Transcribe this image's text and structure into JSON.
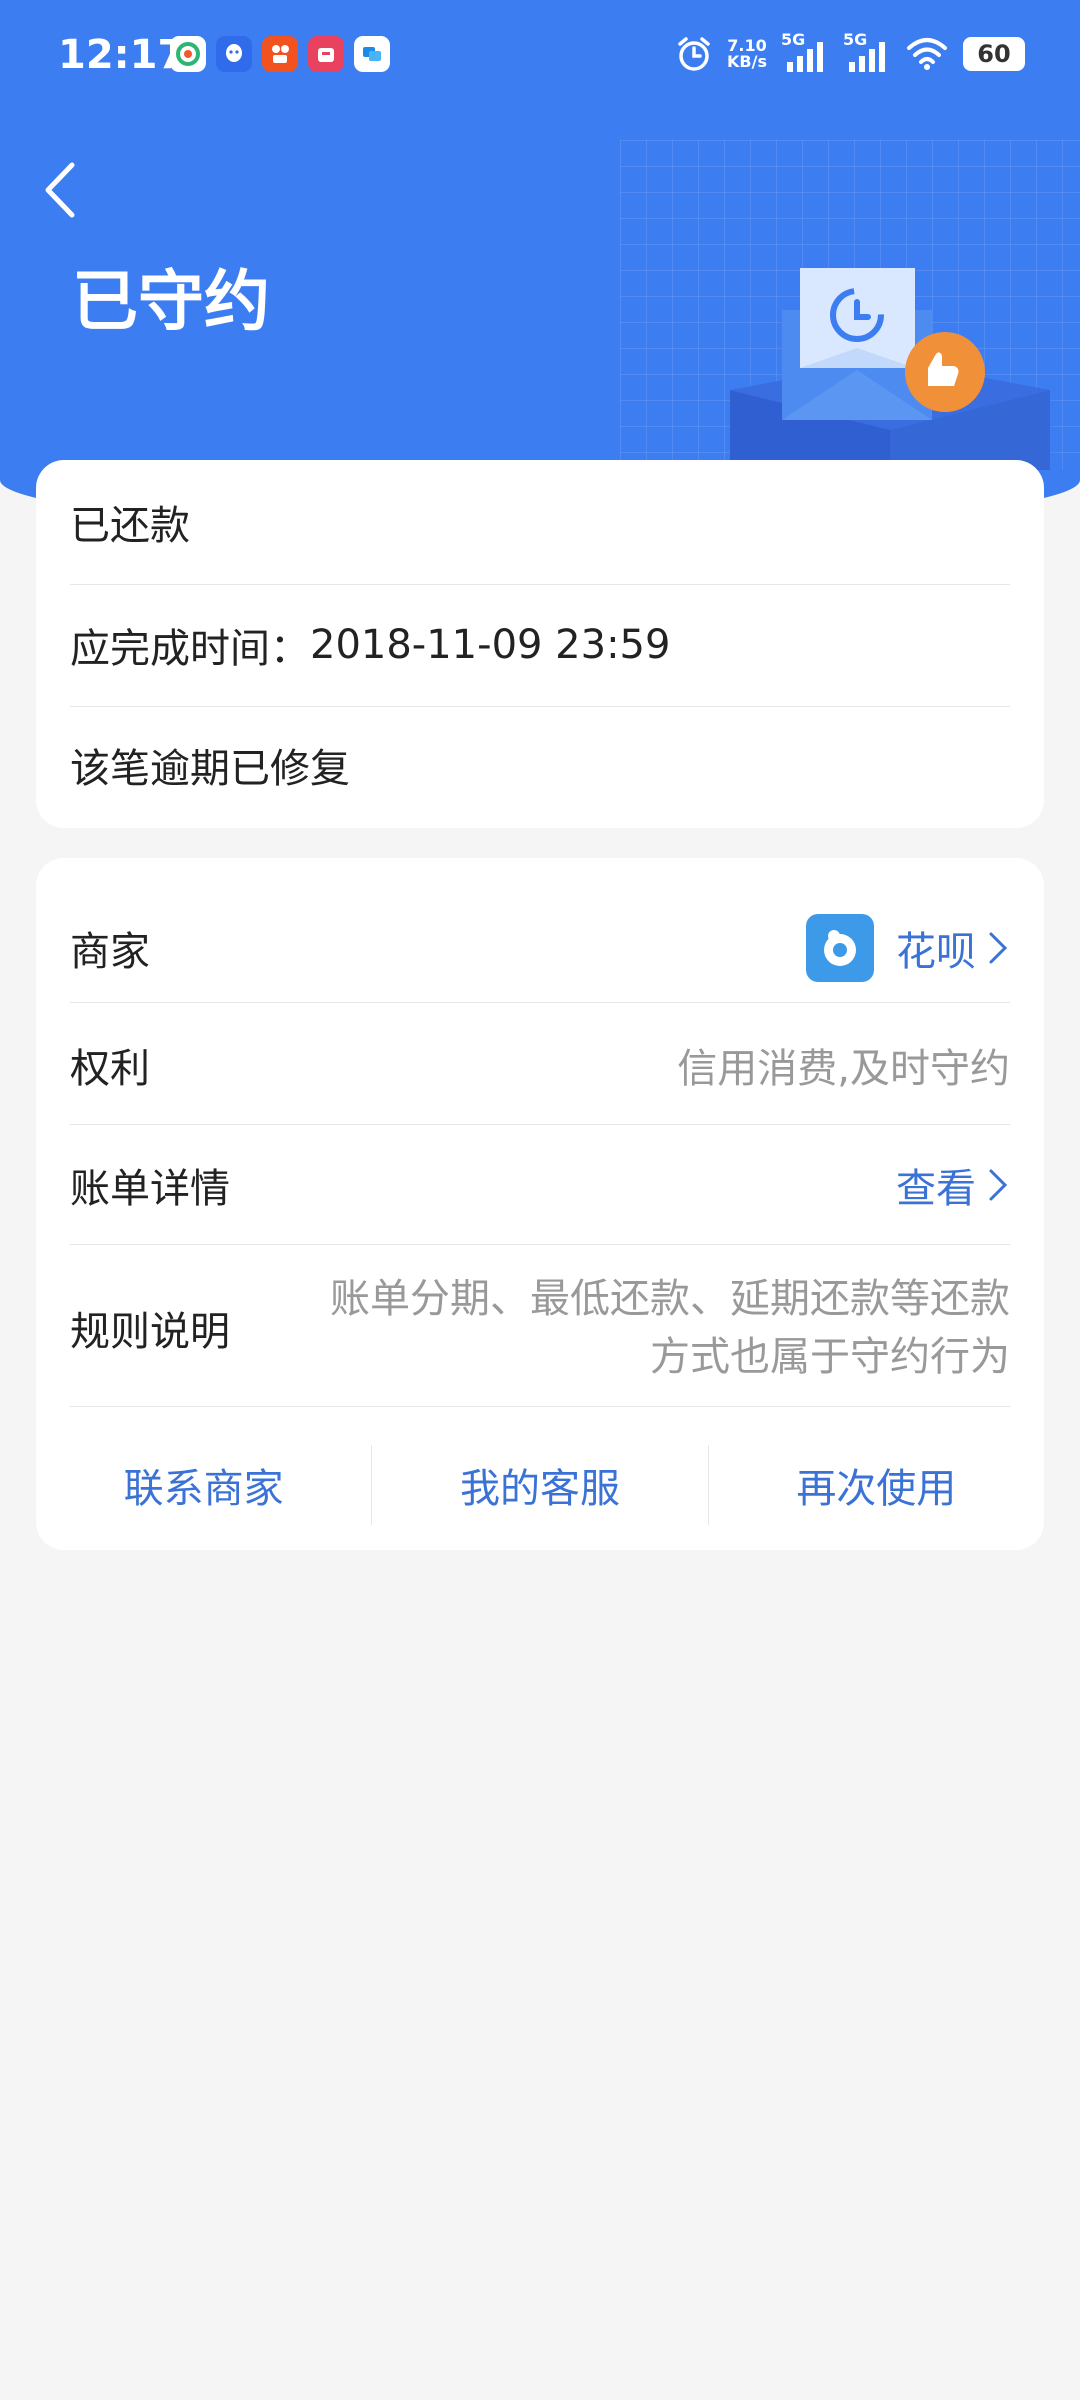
{
  "status_bar": {
    "time": "12:17",
    "speed_value": "7.10",
    "speed_unit": "KB/s",
    "network_1": "5G",
    "network_2": "5G",
    "battery": "60"
  },
  "header": {
    "title": "已守约"
  },
  "status_card": {
    "repaid": "已还款",
    "due_label": "应完成时间：",
    "due_value": "2018-11-09 23:59",
    "fixed": "该笔逾期已修复"
  },
  "detail_card": {
    "merchant_label": "商家",
    "merchant_value": "花呗",
    "rights_label": "权利",
    "rights_value": "信用消费,及时守约",
    "bill_label": "账单详情",
    "bill_value": "查看",
    "rules_label": "规则说明",
    "rules_value_line1": "账单分期、最低还款、延期还款等还款",
    "rules_value_line2": "方式也属于守约行为"
  },
  "actions": {
    "contact_merchant": "联系商家",
    "customer_service": "我的客服",
    "use_again": "再次使用"
  },
  "colors": {
    "header_blue": "#3d7df2",
    "link_blue": "#3a72d6",
    "badge_orange": "#f0913a"
  }
}
